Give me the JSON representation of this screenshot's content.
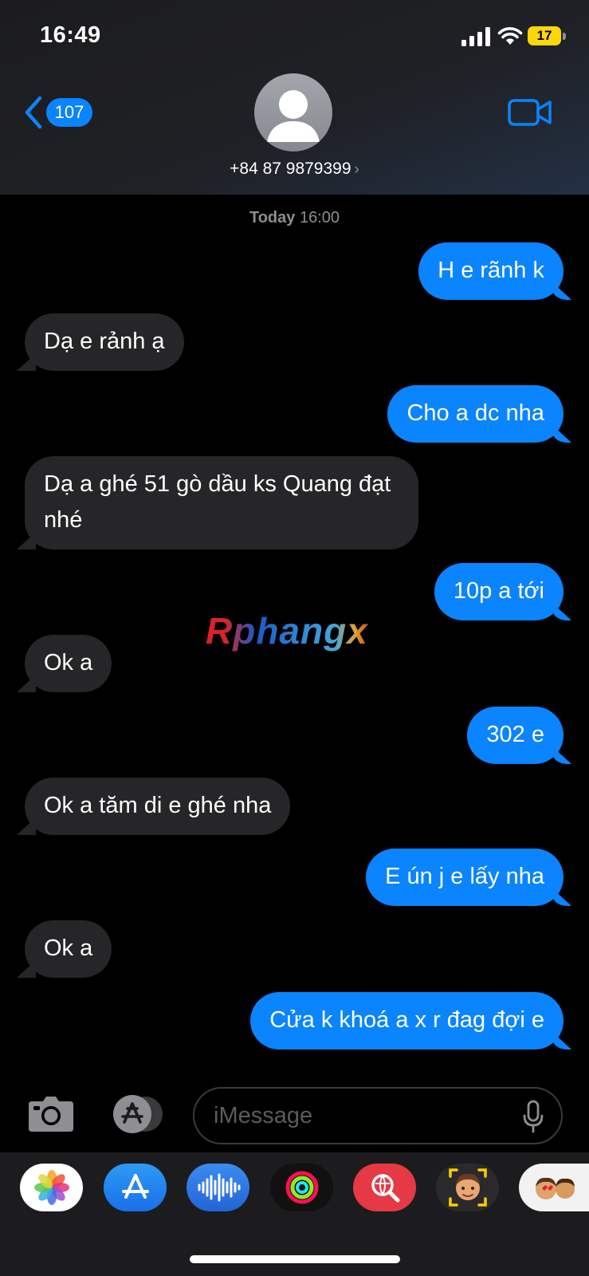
{
  "status_bar": {
    "time": "16:49",
    "battery": "17"
  },
  "header": {
    "back_count": "107",
    "contact": "+84 87 9879399",
    "contact_chevron": "›"
  },
  "conversation": {
    "timestamp_day": "Today",
    "timestamp_time": "16:00",
    "messages": [
      {
        "from": "me",
        "text": "H e rãnh k"
      },
      {
        "from": "them",
        "text": "Dạ e rảnh ạ"
      },
      {
        "from": "me",
        "text": "Cho a dc nha"
      },
      {
        "from": "them",
        "text": "Dạ a ghé 51 gò dầu ks Quang đạt nhé"
      },
      {
        "from": "me",
        "text": "10p a tới"
      },
      {
        "from": "them",
        "text": "Ok a"
      },
      {
        "from": "me",
        "text": "302 e"
      },
      {
        "from": "them",
        "text": "Ok a tăm di e ghé nha"
      },
      {
        "from": "me",
        "text": "E ún j e lấy nha"
      },
      {
        "from": "them",
        "text": "Ok a"
      },
      {
        "from": "me",
        "text": "Cửa k khoá a x r đag đợi e"
      }
    ]
  },
  "watermark": "Rphangx",
  "composer": {
    "placeholder": "iMessage"
  },
  "app_drawer": {
    "apps": [
      {
        "icon": "photos-icon"
      },
      {
        "icon": "app-store-icon"
      },
      {
        "icon": "audio-message-icon"
      },
      {
        "icon": "activity-icon"
      },
      {
        "icon": "web-images-icon"
      },
      {
        "icon": "memoji-icon"
      },
      {
        "icon": "memoji-stickers-icon"
      }
    ]
  },
  "colors": {
    "outgoing_bubble": "#0a84ff",
    "incoming_bubble": "#262628",
    "battery": "#ffd60a"
  }
}
